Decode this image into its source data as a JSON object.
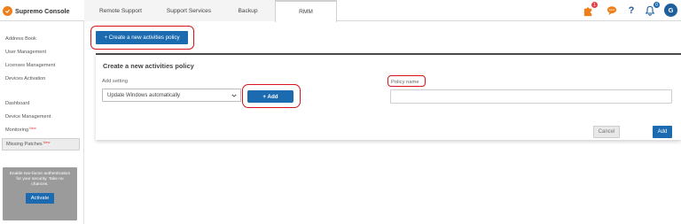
{
  "app": {
    "name": "Supremo Console",
    "logo_icon": "supremo-logo-icon"
  },
  "nav": {
    "tabs": [
      {
        "label": "Remote Support"
      },
      {
        "label": "Support Services"
      },
      {
        "label": "Backup"
      },
      {
        "label": "RMM",
        "active": true
      }
    ]
  },
  "toolbar": {
    "puzzle_badge": "1",
    "bell_badge": "0",
    "help_symbol": "?",
    "avatar_initial": "G"
  },
  "sidebar": {
    "items": [
      {
        "label": "Address Book"
      },
      {
        "label": "User Management"
      },
      {
        "label": "Licenses Management"
      },
      {
        "label": "Devices Activation"
      },
      {
        "label": "Dashboard"
      },
      {
        "label": "Device Management"
      },
      {
        "label": "Monitoring",
        "tag": "New"
      },
      {
        "label": "Missing Patches",
        "tag": "New",
        "active": true
      }
    ],
    "promo": {
      "text": "Enable two-factor authentication for your security. Take no chances.",
      "button_label": "Activate"
    }
  },
  "main": {
    "create_button_label": "+ Create a new activities policy",
    "panel": {
      "title": "Create a new activities policy",
      "add_setting_label": "Add setting",
      "select_value": "Update Windows automatically",
      "add_setting_button": "+ Add",
      "policy_name_label": "Policy name",
      "policy_name_value": "",
      "cancel_label": "Cancel",
      "add_label": "Add"
    }
  },
  "colors": {
    "primary": "#1c6bb0",
    "accent": "#f07f1b",
    "highlight": "#d9141e",
    "avatar": "#1f5f9c"
  }
}
